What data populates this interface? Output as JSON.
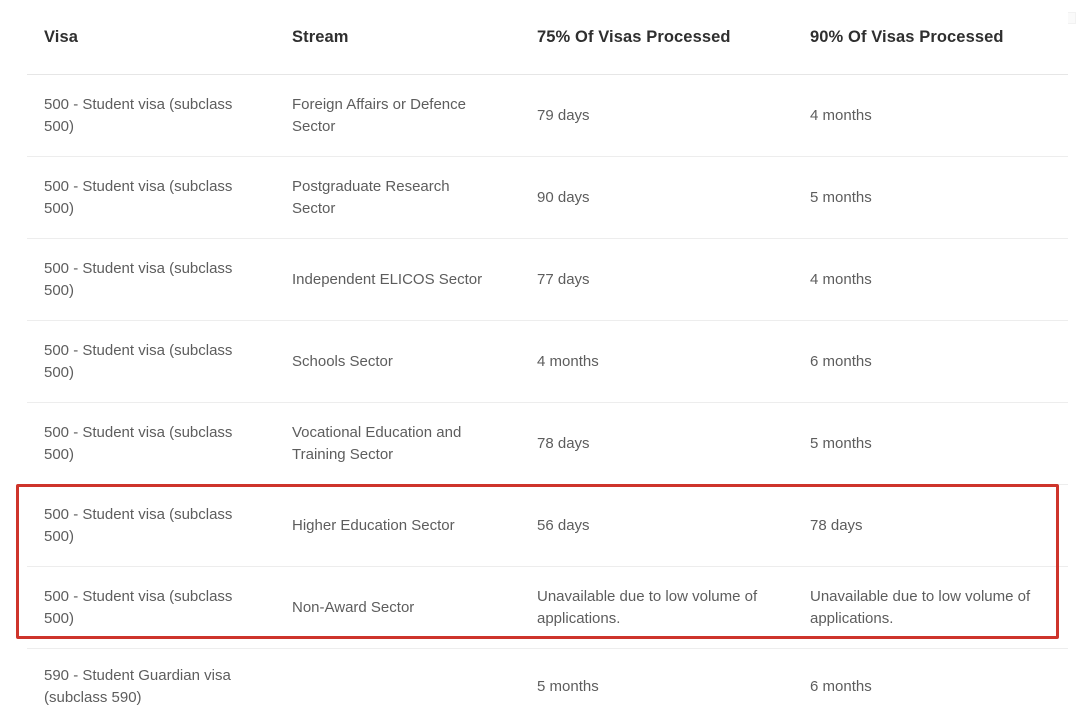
{
  "table": {
    "columns": [
      {
        "key": "visa",
        "label": "Visa"
      },
      {
        "key": "stream",
        "label": "Stream"
      },
      {
        "key": "p75",
        "label": "75% Of Visas Processed"
      },
      {
        "key": "p90",
        "label": "90% Of Visas Processed"
      }
    ],
    "rows": [
      {
        "visa": "500 - Student visa (subclass 500)",
        "stream": "Foreign Affairs or Defence Sector",
        "p75": "79 days",
        "p90": "4 months"
      },
      {
        "visa": "500 - Student visa (subclass 500)",
        "stream": "Postgraduate Research Sector",
        "p75": "90 days",
        "p90": "5 months"
      },
      {
        "visa": "500 - Student visa (subclass 500)",
        "stream": "Independent ELICOS Sector",
        "p75": "77 days",
        "p90": "4 months"
      },
      {
        "visa": "500 - Student visa (subclass 500)",
        "stream": "Schools Sector",
        "p75": "4 months",
        "p90": "6 months"
      },
      {
        "visa": "500 - Student visa (subclass 500)",
        "stream": "Vocational Education and Training Sector",
        "p75": "78 days",
        "p90": "5 months"
      },
      {
        "visa": "500 - Student visa (subclass 500)",
        "stream": "Higher Education Sector",
        "p75": "56 days",
        "p90": "78 days"
      },
      {
        "visa": "500 - Student visa (subclass 500)",
        "stream": "Non-Award Sector",
        "p75": "Unavailable due to low volume of applications.",
        "p90": "Unavailable due to low volume of applications."
      },
      {
        "visa": "590 - Student Guardian visa (subclass 590)",
        "stream": "",
        "p75": "5 months",
        "p90": "6 months"
      }
    ]
  },
  "annotation": {
    "highlight_color": "#ce342b",
    "highlighted_row_indices": [
      5,
      6
    ]
  },
  "theme": {
    "background": "#ffffff",
    "header_text": "#2f2f2f",
    "body_text": "#5d5d5d",
    "row_divider": "#ededed",
    "header_divider": "#e6e6e6"
  }
}
